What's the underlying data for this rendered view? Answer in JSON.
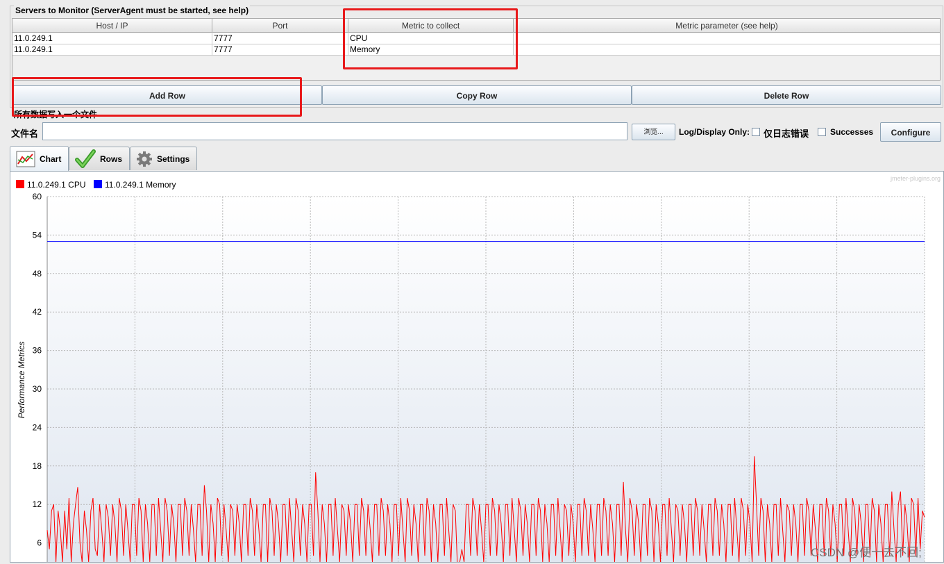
{
  "servers": {
    "group_title": "Servers to Monitor (ServerAgent must be started, see help)",
    "columns": [
      "Host / IP",
      "Port",
      "Metric to collect",
      "Metric parameter (see help)"
    ],
    "rows": [
      [
        "11.0.249.1",
        "7777",
        "CPU",
        ""
      ],
      [
        "11.0.249.1",
        "7777",
        "Memory",
        ""
      ]
    ],
    "buttons": {
      "add": "Add Row",
      "copy": "Copy Row",
      "delete": "Delete Row"
    }
  },
  "file": {
    "section_label": "所有数据写入一个文件",
    "filename_label": "文件名",
    "filename_value": "",
    "browse": "浏览...",
    "log_display_only": "Log/Display Only:",
    "errors_only": "仅日志错误",
    "successes": "Successes",
    "configure": "Configure"
  },
  "tabs": [
    {
      "label": "Chart",
      "icon": "line-chart-icon"
    },
    {
      "label": "Rows",
      "icon": "checkmark-icon"
    },
    {
      "label": "Settings",
      "icon": "gear-icon"
    }
  ],
  "chart_watermark": "jmeter-plugins.org",
  "watermark_bottom": "CSDN @便一去不回;",
  "colors": {
    "cpu": "#ff0000",
    "memory": "#0000ff",
    "highlight": "#e8191b"
  },
  "chart_data": {
    "type": "line",
    "ylabel": "Performance Metrics",
    "ylim": [
      0,
      60
    ],
    "yticks": [
      6,
      12,
      18,
      24,
      30,
      36,
      42,
      48,
      54,
      60
    ],
    "grid": true,
    "legend_placement": "top-left",
    "series": [
      {
        "name": "11.0.249.1 CPU",
        "color": "#ff0000",
        "values": [
          8,
          5,
          11,
          12,
          3,
          11,
          8,
          3,
          11,
          5,
          13,
          3,
          9,
          12,
          14.7,
          6,
          3,
          11,
          8,
          3,
          11,
          13,
          5,
          4,
          12,
          8,
          3,
          12,
          10,
          4,
          12,
          9,
          3,
          13,
          11,
          4,
          12,
          8,
          3,
          12,
          12,
          4,
          13,
          11,
          3,
          12,
          9,
          3,
          12,
          12,
          4,
          13,
          8,
          3,
          13,
          11,
          4,
          12,
          9,
          3,
          12,
          12,
          4,
          13,
          11,
          4,
          12,
          8,
          3,
          12,
          12,
          4,
          15,
          11,
          3,
          12,
          9,
          3,
          13,
          12,
          4,
          12,
          8,
          3,
          12,
          11,
          4,
          12,
          9,
          3,
          12,
          12,
          4,
          13,
          11,
          4,
          12,
          8,
          3,
          12,
          12,
          3,
          13,
          11,
          4,
          12,
          9,
          3,
          12,
          12,
          4,
          13,
          8,
          3,
          13,
          11,
          4,
          12,
          9,
          3,
          12,
          12,
          4,
          17,
          11,
          3,
          12,
          9,
          3,
          12,
          12,
          4,
          13,
          8,
          3,
          12,
          11,
          4,
          12,
          9,
          3,
          12,
          12,
          4,
          13,
          11,
          4,
          12,
          8,
          3,
          12,
          12,
          4,
          13,
          11,
          4,
          12,
          9,
          3,
          12,
          12,
          4,
          13,
          8,
          3,
          13,
          11,
          4,
          12,
          9,
          3,
          12,
          12,
          4,
          13,
          11,
          3,
          12,
          9,
          3,
          12,
          12,
          4,
          13,
          8,
          3,
          12,
          11,
          2,
          3,
          5,
          3,
          12,
          12,
          4,
          13,
          11,
          4,
          12,
          8,
          3,
          12,
          12,
          4,
          13,
          11,
          4,
          12,
          9,
          3,
          12,
          12,
          4,
          13,
          8,
          3,
          13,
          11,
          4,
          12,
          9,
          3,
          12,
          12,
          4,
          13,
          11,
          3,
          12,
          9,
          3,
          12,
          12,
          4,
          13,
          8,
          3,
          12,
          11,
          4,
          12,
          9,
          3,
          12,
          12,
          4,
          13,
          11,
          4,
          12,
          8,
          3,
          12,
          12,
          4,
          13,
          11,
          4,
          12,
          9,
          3,
          12,
          12,
          4,
          15.5,
          8,
          3,
          13,
          11,
          4,
          12,
          9,
          3,
          12,
          12,
          4,
          13,
          11,
          3,
          12,
          9,
          3,
          12,
          12,
          4,
          13,
          8,
          3,
          12,
          11,
          4,
          12,
          9,
          3,
          12,
          12,
          4,
          13,
          11,
          4,
          12,
          8,
          3,
          12,
          12,
          4,
          13,
          11,
          4,
          12,
          9,
          3,
          12,
          12,
          4,
          13,
          8,
          3,
          13,
          11,
          4,
          12,
          9,
          3,
          19.5,
          12,
          4,
          13,
          11,
          3,
          12,
          9,
          3,
          12,
          12,
          4,
          13,
          8,
          3,
          12,
          11,
          4,
          12,
          9,
          3,
          12,
          12,
          4,
          13,
          11,
          4,
          12,
          8,
          3,
          12,
          12,
          4,
          13,
          11,
          4,
          12,
          9,
          3,
          12,
          12,
          4,
          13,
          8,
          3,
          13,
          11,
          4,
          12,
          9,
          3,
          12,
          12,
          4,
          13,
          11,
          3,
          12,
          9,
          3,
          12,
          12,
          4,
          14,
          8,
          3,
          12,
          14,
          4,
          12,
          9,
          3,
          13,
          12,
          4,
          13,
          5,
          11,
          10
        ]
      },
      {
        "name": "11.0.249.1 Memory",
        "color": "#0000ff",
        "values": [
          53,
          53
        ]
      }
    ]
  }
}
